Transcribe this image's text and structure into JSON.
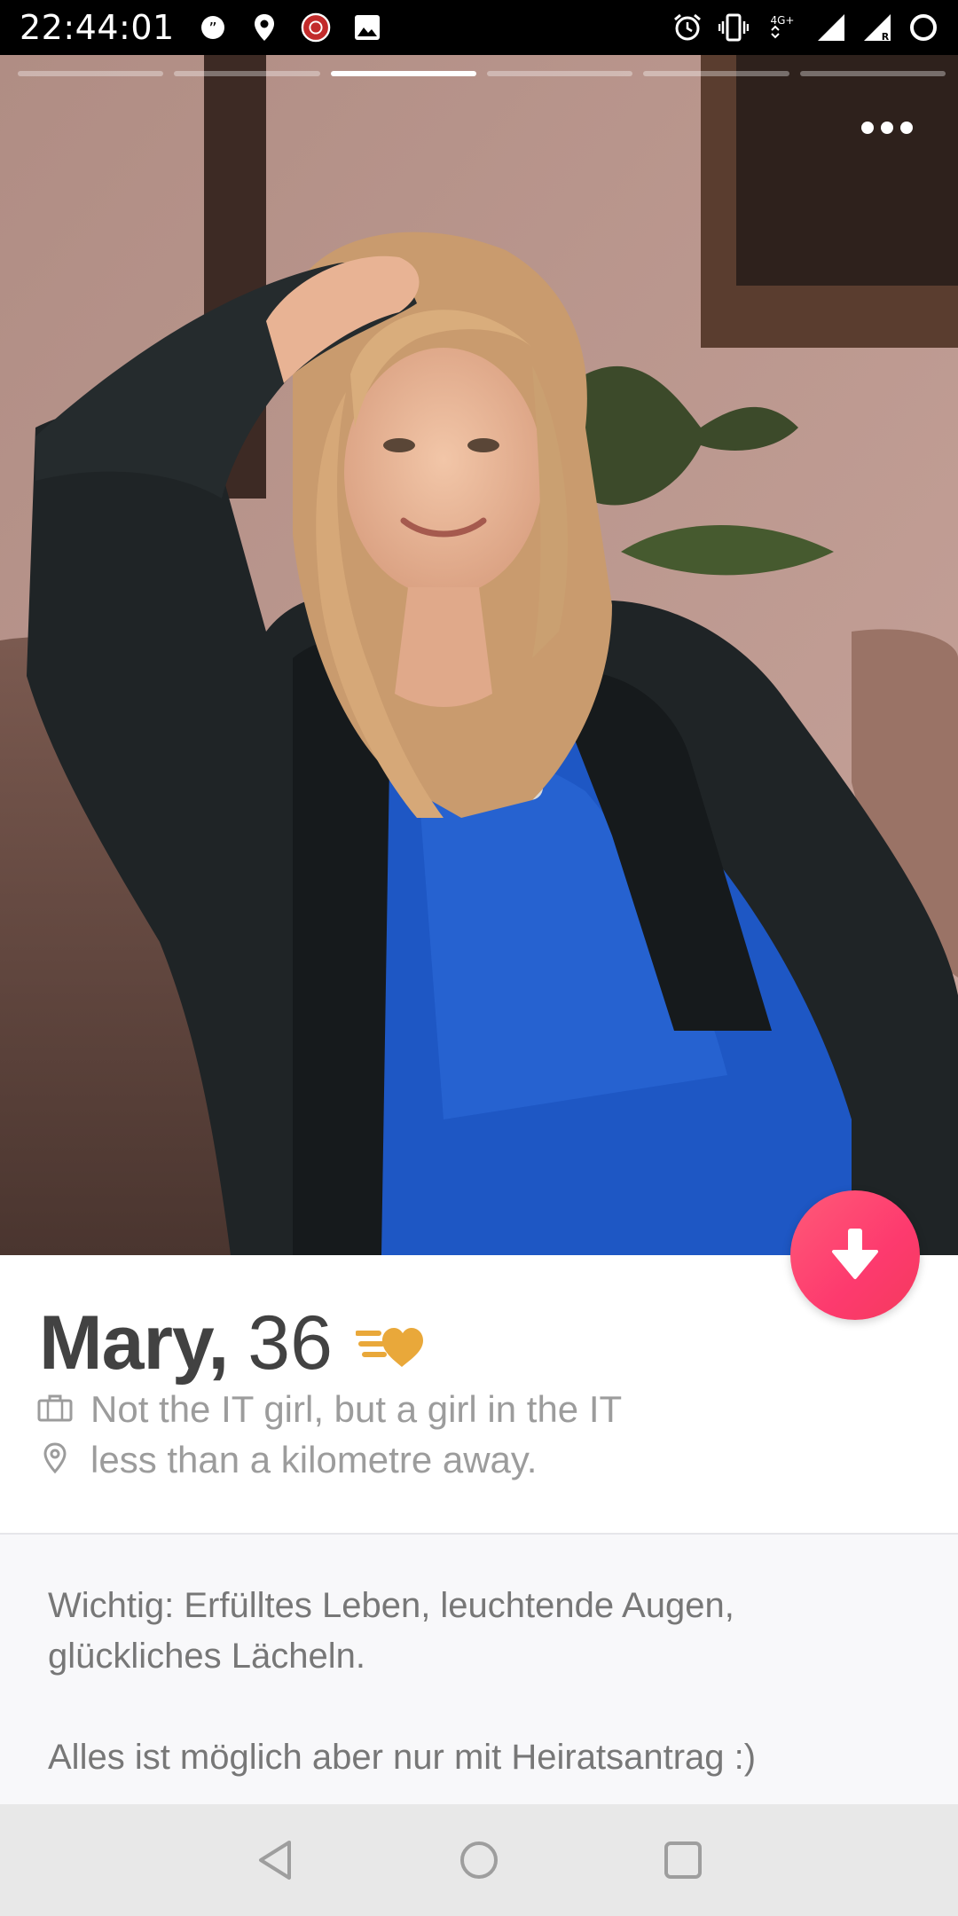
{
  "status_bar": {
    "time": "22:44:01",
    "left_icons": [
      "quote-icon",
      "location-pin-icon",
      "app-badge-icon",
      "image-icon"
    ],
    "right_icons": [
      "alarm-icon",
      "vibrate-icon",
      "network-4g-icon",
      "signal-icon",
      "roaming-signal-icon",
      "battery-ring-icon"
    ],
    "network_label": "4G⁺"
  },
  "photo": {
    "progress_total": 6,
    "progress_active_index": 2,
    "more_icon": "more-dots-icon"
  },
  "profile": {
    "name": "Mary,",
    "age": "36",
    "boost_icon": "super-boost-heart-icon",
    "job_icon": "briefcase-icon",
    "job": "Not the IT girl, but a girl in the IT",
    "distance_icon": "location-icon",
    "distance": "less than a kilometre away."
  },
  "bio": {
    "line1": "Wichtig: Erfülltes Leben, leuchtende Augen,",
    "line2": "glückliches Lächeln.",
    "line3": "Alles ist möglich aber nur mit Heiratsantrag :)"
  },
  "collapse_button": {
    "icon": "arrow-down-icon"
  },
  "nav_bar": {
    "buttons": [
      "back-triangle-icon",
      "home-circle-icon",
      "recents-square-icon"
    ]
  },
  "colors": {
    "accent_gradient_start": "#ff5a78",
    "accent_gradient_end": "#f43a5d",
    "boost_gold": "#e9a83a",
    "name_text": "#424242",
    "detail_text": "#9c9c9c",
    "bio_text": "#777777"
  }
}
